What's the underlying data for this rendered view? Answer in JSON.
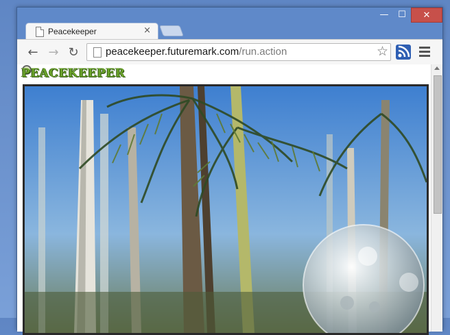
{
  "tab": {
    "title": "Peacekeeper",
    "close_glyph": "×"
  },
  "window_controls": {
    "minimize": "—",
    "maximize": "☐",
    "close": "✕"
  },
  "toolbar": {
    "back_glyph": "←",
    "forward_glyph": "→",
    "reload_glyph": "↻",
    "url_host": "peacekeeper.futuremark.com",
    "url_path": "/run.action",
    "star_glyph": "☆"
  },
  "page": {
    "logo_text": "PEACEKEEPER"
  },
  "icons": {
    "tab_page": "page-icon",
    "rss": "rss-icon",
    "menu": "hamburger-menu-icon"
  }
}
